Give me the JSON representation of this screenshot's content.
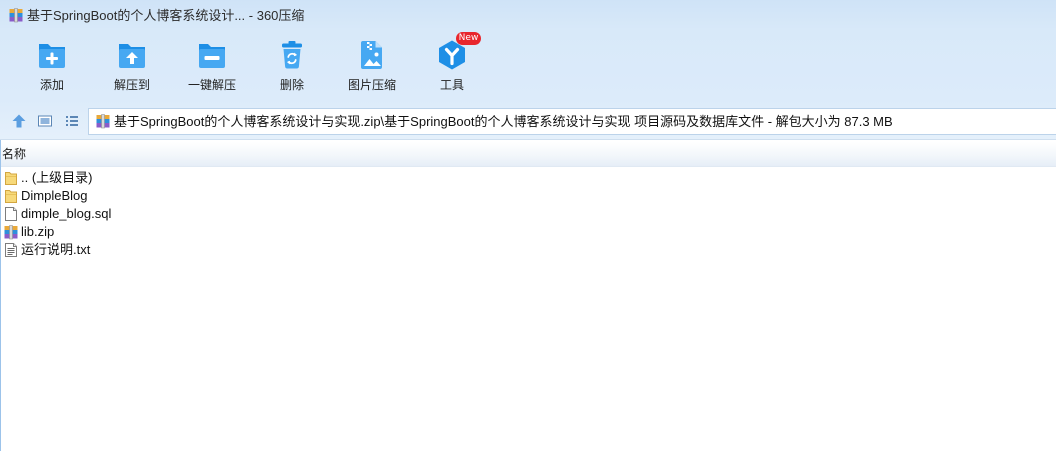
{
  "window": {
    "title": "基于SpringBoot的个人博客系统设计... - 360压缩",
    "app_icon": "zip-archive-icon"
  },
  "toolbar": {
    "buttons": [
      {
        "label": "添加",
        "icon": "add-folder-icon"
      },
      {
        "label": "解压到",
        "icon": "extract-to-icon"
      },
      {
        "label": "一键解压",
        "icon": "one-click-extract-icon"
      },
      {
        "label": "删除",
        "icon": "trash-icon"
      },
      {
        "label": "图片压缩",
        "icon": "image-compress-icon"
      },
      {
        "label": "工具",
        "icon": "tools-icon",
        "badge": "New"
      }
    ]
  },
  "nav": {
    "up_icon": "up-arrow-icon",
    "view_icons": [
      "detail-view-icon",
      "list-view-icon"
    ]
  },
  "address_bar": {
    "icon": "zip-archive-icon",
    "path": "基于SpringBoot的个人博客系统设计与实现.zip\\基于SpringBoot的个人博客系统设计与实现 项目源码及数据库文件 - 解包大小为 87.3 MB"
  },
  "file_list": {
    "columns": [
      "名称"
    ],
    "items": [
      {
        "name": ".. (上级目录)",
        "icon": "folder-icon"
      },
      {
        "name": "DimpleBlog",
        "icon": "folder-icon"
      },
      {
        "name": "dimple_blog.sql",
        "icon": "file-icon"
      },
      {
        "name": "lib.zip",
        "icon": "zip-archive-icon"
      },
      {
        "name": "运行说明.txt",
        "icon": "text-file-icon"
      }
    ]
  },
  "colors": {
    "accent": "#1e8fe6",
    "accent_light": "#46a8f2",
    "badge": "#e8262d",
    "folder": "#f7d97a"
  }
}
